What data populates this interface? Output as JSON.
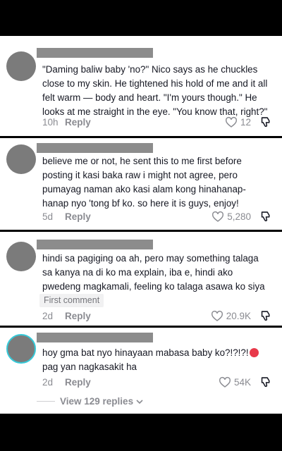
{
  "comments": [
    {
      "text": "\"Daming baliw baby 'no?\" Nico says as he chuckles close to my skin. He tightened his hold of me and it all felt warm — body and heart. \"I'm yours though.\" He looks at me straight in the eye. \"You know that, right?\"",
      "time": "10h",
      "reply": "Reply",
      "likes": "12"
    },
    {
      "text": "believe me or not, he sent this to me first before posting it kasi baka raw i might not agree, pero pumayag naman ako kasi alam kong hinahanap-hanap nyo 'tong bf ko. so here it is guys, enjoy!",
      "time": "5d",
      "reply": "Reply",
      "likes": "5,280"
    },
    {
      "text": "hindi sa pagiging oa ah, pero may something talaga sa kanya na di ko ma explain, iba e, hindi ako pwedeng magkamali, feeling ko talaga asawa ko siya dati",
      "badge": "First comment",
      "time": "2d",
      "reply": "Reply",
      "likes": "20.9K"
    },
    {
      "text_before": "hoy gma bat nyo hinayaan mabasa baby ko?!?!?!",
      "emoji": "angry-face",
      "text_after": "pag yan nagkasakit ha",
      "time": "2d",
      "reply": "Reply",
      "likes": "54K",
      "view_replies": "View 129 replies"
    }
  ],
  "colors": {
    "text": "#161823",
    "meta": "#8a8b91",
    "avatar": "#7b7b7b",
    "story_ring": "#36c9d8"
  }
}
